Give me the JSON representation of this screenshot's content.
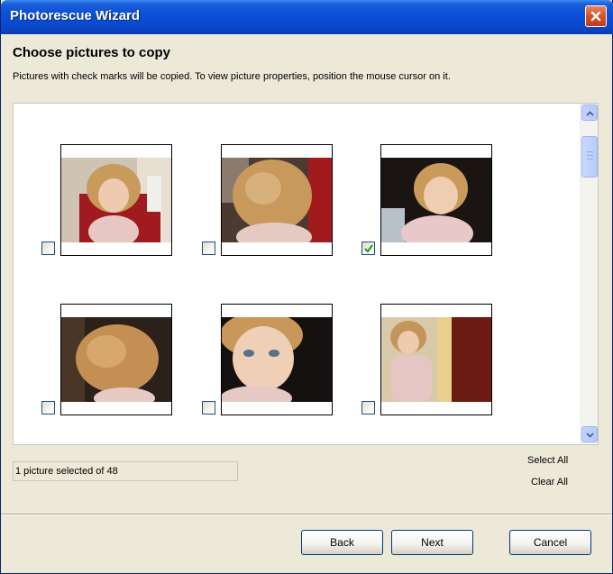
{
  "window": {
    "title": "Photorescue Wizard",
    "close_icon": "close-x-icon"
  },
  "page": {
    "heading": "Choose pictures to copy",
    "instructions": "Pictures with check marks will be copied.  To view picture properties, position the mouse cursor on it."
  },
  "thumbnails": [
    {
      "checked": false,
      "subject": "toddler-front-red-chair"
    },
    {
      "checked": false,
      "subject": "toddler-back-of-head"
    },
    {
      "checked": true,
      "subject": "toddler-front-dark-background"
    },
    {
      "checked": false,
      "subject": "toddler-head-from-side"
    },
    {
      "checked": false,
      "subject": "toddler-closeup-face"
    },
    {
      "checked": false,
      "subject": "toddler-sitting-wood-door"
    }
  ],
  "status": {
    "selection_text": "1 picture selected of 48"
  },
  "actions": {
    "select_all": "Select All",
    "clear_all": "Clear All"
  },
  "buttons": {
    "back": "Back",
    "next": "Next",
    "cancel": "Cancel"
  },
  "colors": {
    "titlebar": "#0b4fd8",
    "dialog_bg": "#ece9d8",
    "checkmark": "#21a121"
  }
}
